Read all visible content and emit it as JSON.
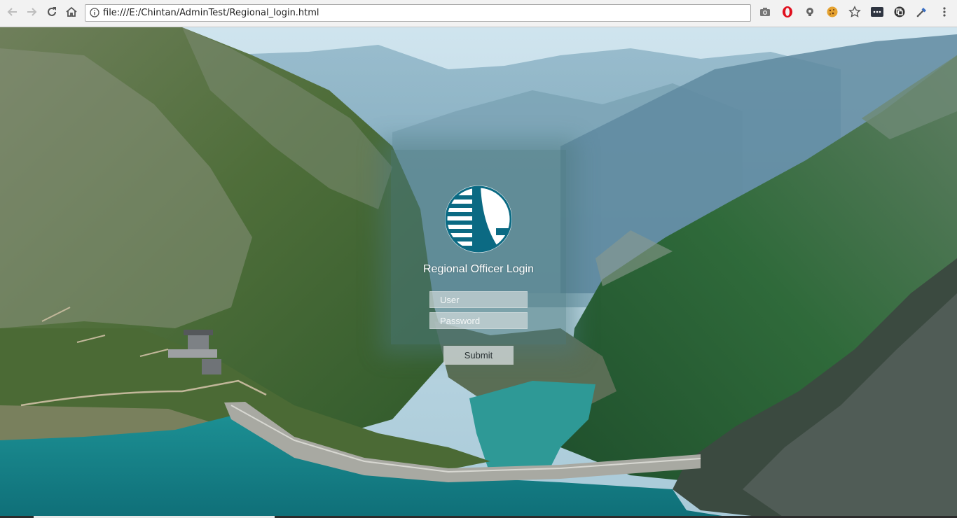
{
  "browser": {
    "url": "file:///E:/Chintan/AdminTest/Regional_login.html",
    "nav": {
      "back_icon": "arrow-left-icon",
      "forward_icon": "arrow-right-icon",
      "reload_icon": "reload-icon",
      "home_icon": "home-icon"
    },
    "extensions": [
      "camera-icon",
      "opera-icon",
      "bulb-icon",
      "cookie-icon",
      "star-icon",
      "dots-extension-icon",
      "copy-extension-icon",
      "eyedropper-icon",
      "menu-icon"
    ]
  },
  "login": {
    "title": "Regional Officer Login",
    "user_placeholder": "User",
    "password_placeholder": "Password",
    "submit_label": "Submit"
  },
  "colors": {
    "logo_fill": "#0b6a83",
    "card_tint": "#4b787d",
    "water": "#16848a"
  }
}
